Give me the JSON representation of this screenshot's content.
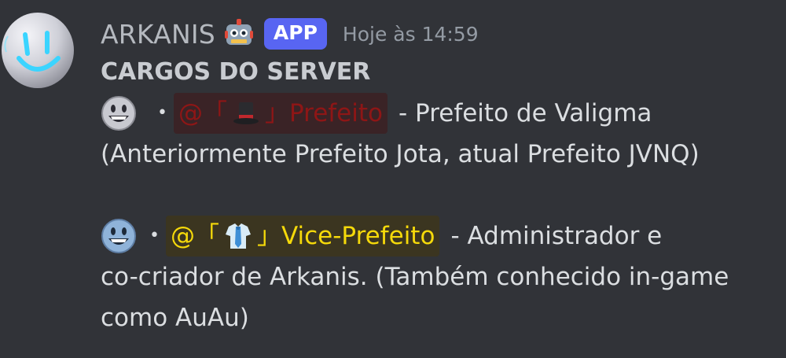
{
  "message": {
    "author": "ARKANIS",
    "badge": "APP",
    "timestamp": "Hoje às 14:59",
    "title": "CARGOS DO SERVER"
  },
  "roles": [
    {
      "bullet": "•",
      "mention_prefix": "@「",
      "mention_suffix": "」Prefeito",
      "description_line1": "- Prefeito de Valigma",
      "description_line2": "(Anteriormente Prefeito Jota, atual Prefeito JVNQ)",
      "icon": "top-hat-icon",
      "face_icon": "grinning-face-icon",
      "color": "#8e1616"
    },
    {
      "bullet": "•",
      "mention_prefix": "@「",
      "mention_suffix": "」Vice-Prefeito",
      "description_line1": "- Administrador e",
      "description_line2": "co-criador de Arkanis. (Também conhecido in-game",
      "description_line3": "como AuAu)",
      "icon": "shirt-tie-icon",
      "face_icon": "blue-smiling-face-icon",
      "color": "#f5d90a"
    }
  ],
  "colors": {
    "background": "#313338",
    "app_badge": "#5865f2"
  }
}
